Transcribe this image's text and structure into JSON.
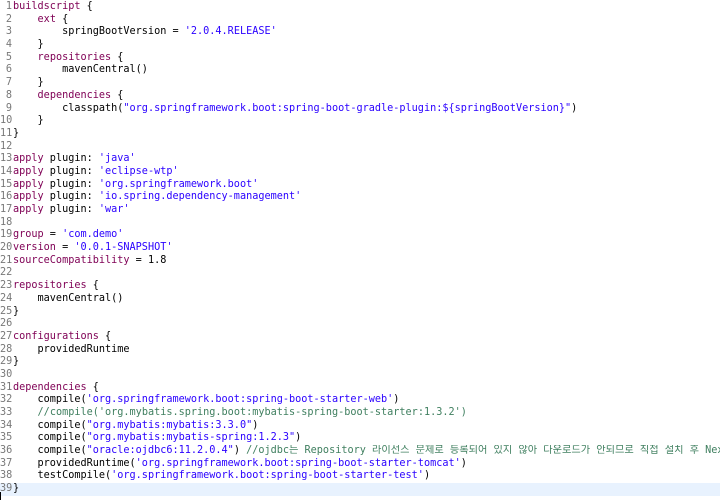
{
  "colors": {
    "keyword": "#7f0055",
    "string": "#2a00ff",
    "comment": "#3f7f5f",
    "plain": "#000000",
    "line_number": "#787878",
    "current_line": "#e8f2fe"
  },
  "current_line": 39,
  "lines": [
    {
      "n": "1",
      "t": [
        {
          "c": "kw",
          "v": "buildscript"
        },
        {
          "c": "pl",
          "v": " {"
        }
      ]
    },
    {
      "n": "2",
      "t": [
        {
          "c": "pl",
          "v": "    "
        },
        {
          "c": "kw",
          "v": "ext"
        },
        {
          "c": "pl",
          "v": " {"
        }
      ]
    },
    {
      "n": "3",
      "t": [
        {
          "c": "pl",
          "v": "        springBootVersion = "
        },
        {
          "c": "str",
          "v": "'2.0.4.RELEASE'"
        }
      ]
    },
    {
      "n": "4",
      "t": [
        {
          "c": "pl",
          "v": "    }"
        }
      ]
    },
    {
      "n": "5",
      "t": [
        {
          "c": "pl",
          "v": "    "
        },
        {
          "c": "kw",
          "v": "repositories"
        },
        {
          "c": "pl",
          "v": " {"
        }
      ]
    },
    {
      "n": "6",
      "t": [
        {
          "c": "pl",
          "v": "        mavenCentral()"
        }
      ]
    },
    {
      "n": "7",
      "t": [
        {
          "c": "pl",
          "v": "    }"
        }
      ]
    },
    {
      "n": "8",
      "t": [
        {
          "c": "pl",
          "v": "    "
        },
        {
          "c": "kw",
          "v": "dependencies"
        },
        {
          "c": "pl",
          "v": " {"
        }
      ]
    },
    {
      "n": "9",
      "t": [
        {
          "c": "pl",
          "v": "        classpath("
        },
        {
          "c": "str",
          "v": "\"org.springframework.boot:spring-boot-gradle-plugin:${springBootVersion}\""
        },
        {
          "c": "pl",
          "v": ")"
        }
      ]
    },
    {
      "n": "10",
      "t": [
        {
          "c": "pl",
          "v": "    }"
        }
      ]
    },
    {
      "n": "11",
      "t": [
        {
          "c": "pl",
          "v": "}"
        }
      ]
    },
    {
      "n": "12",
      "t": []
    },
    {
      "n": "13",
      "t": [
        {
          "c": "kw",
          "v": "apply"
        },
        {
          "c": "pl",
          "v": " plugin: "
        },
        {
          "c": "str",
          "v": "'java'"
        }
      ]
    },
    {
      "n": "14",
      "t": [
        {
          "c": "kw",
          "v": "apply"
        },
        {
          "c": "pl",
          "v": " plugin: "
        },
        {
          "c": "str",
          "v": "'eclipse-wtp'"
        }
      ]
    },
    {
      "n": "15",
      "t": [
        {
          "c": "kw",
          "v": "apply"
        },
        {
          "c": "pl",
          "v": " plugin: "
        },
        {
          "c": "str",
          "v": "'org.springframework.boot'"
        }
      ]
    },
    {
      "n": "16",
      "t": [
        {
          "c": "kw",
          "v": "apply"
        },
        {
          "c": "pl",
          "v": " plugin: "
        },
        {
          "c": "str",
          "v": "'io.spring.dependency-management'"
        }
      ]
    },
    {
      "n": "17",
      "t": [
        {
          "c": "kw",
          "v": "apply"
        },
        {
          "c": "pl",
          "v": " plugin: "
        },
        {
          "c": "str",
          "v": "'war'"
        }
      ]
    },
    {
      "n": "18",
      "t": []
    },
    {
      "n": "19",
      "t": [
        {
          "c": "kw",
          "v": "group"
        },
        {
          "c": "pl",
          "v": " = "
        },
        {
          "c": "str",
          "v": "'com.demo'"
        }
      ]
    },
    {
      "n": "20",
      "t": [
        {
          "c": "kw",
          "v": "version"
        },
        {
          "c": "pl",
          "v": " = "
        },
        {
          "c": "str",
          "v": "'0.0.1-SNAPSHOT'"
        }
      ]
    },
    {
      "n": "21",
      "t": [
        {
          "c": "kw",
          "v": "sourceCompatibility"
        },
        {
          "c": "pl",
          "v": " = 1.8"
        }
      ]
    },
    {
      "n": "22",
      "t": []
    },
    {
      "n": "23",
      "t": [
        {
          "c": "kw",
          "v": "repositories"
        },
        {
          "c": "pl",
          "v": " {"
        }
      ]
    },
    {
      "n": "24",
      "t": [
        {
          "c": "pl",
          "v": "    mavenCentral()"
        }
      ]
    },
    {
      "n": "25",
      "t": [
        {
          "c": "pl",
          "v": "}"
        }
      ]
    },
    {
      "n": "26",
      "t": []
    },
    {
      "n": "27",
      "t": [
        {
          "c": "kw",
          "v": "configurations"
        },
        {
          "c": "pl",
          "v": " {"
        }
      ]
    },
    {
      "n": "28",
      "t": [
        {
          "c": "pl",
          "v": "    providedRuntime"
        }
      ]
    },
    {
      "n": "29",
      "t": [
        {
          "c": "pl",
          "v": "}"
        }
      ]
    },
    {
      "n": "30",
      "t": []
    },
    {
      "n": "31",
      "t": [
        {
          "c": "kw",
          "v": "dependencies"
        },
        {
          "c": "pl",
          "v": " {"
        }
      ]
    },
    {
      "n": "32",
      "t": [
        {
          "c": "pl",
          "v": "    compile("
        },
        {
          "c": "str",
          "v": "'org.springframework.boot:spring-boot-starter-web'"
        },
        {
          "c": "pl",
          "v": ")"
        }
      ]
    },
    {
      "n": "33",
      "t": [
        {
          "c": "pl",
          "v": "    "
        },
        {
          "c": "cm",
          "v": "//compile('org.mybatis.spring.boot:mybatis-spring-boot-starter:1.3.2')"
        }
      ]
    },
    {
      "n": "34",
      "t": [
        {
          "c": "pl",
          "v": "    compile("
        },
        {
          "c": "str",
          "v": "\"org.mybatis:mybatis:3.3.0\""
        },
        {
          "c": "pl",
          "v": ")"
        }
      ]
    },
    {
      "n": "35",
      "t": [
        {
          "c": "pl",
          "v": "    compile("
        },
        {
          "c": "str",
          "v": "\"org.mybatis:mybatis-spring:1.2.3\""
        },
        {
          "c": "pl",
          "v": ")"
        }
      ]
    },
    {
      "n": "36",
      "t": [
        {
          "c": "pl",
          "v": "    compile("
        },
        {
          "c": "str",
          "v": "\"oracle:ojdbc6:11.2.0.4\""
        },
        {
          "c": "pl",
          "v": ") "
        },
        {
          "c": "cm",
          "v": "//ojdbc는 Repository 라이선스 문제로 등록되어 있지 않아 다운로드가 안되므로 직접 설치 후 Nexus 같은 서버에 업로드하여 다운받으셔야 합니다."
        }
      ]
    },
    {
      "n": "37",
      "t": [
        {
          "c": "pl",
          "v": "    providedRuntime("
        },
        {
          "c": "str",
          "v": "'org.springframework.boot:spring-boot-starter-tomcat'"
        },
        {
          "c": "pl",
          "v": ")"
        }
      ]
    },
    {
      "n": "38",
      "t": [
        {
          "c": "pl",
          "v": "    testCompile("
        },
        {
          "c": "str",
          "v": "'org.springframework.boot:spring-boot-starter-test'"
        },
        {
          "c": "pl",
          "v": ")"
        }
      ]
    },
    {
      "n": "39",
      "t": [
        {
          "c": "pl",
          "v": "}"
        }
      ]
    }
  ]
}
